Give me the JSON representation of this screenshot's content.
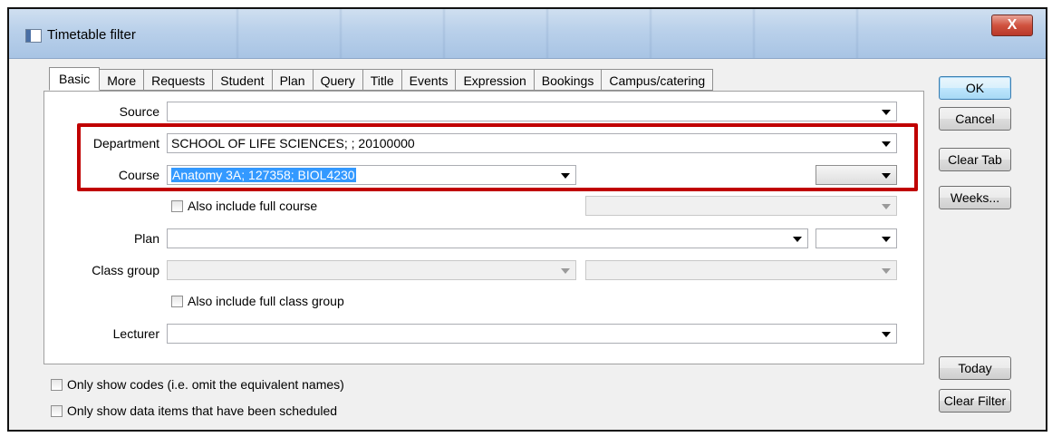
{
  "window": {
    "title": "Timetable filter",
    "close_glyph": "X"
  },
  "tabs": [
    "Basic",
    "More",
    "Requests",
    "Student",
    "Plan",
    "Query",
    "Title",
    "Events",
    "Expression",
    "Bookings",
    "Campus/catering"
  ],
  "form": {
    "source_label": "Source",
    "source_value": "",
    "department_label": "Department",
    "department_value": "SCHOOL OF LIFE SCIENCES; ; 20100000",
    "course_label": "Course",
    "course_value": "Anatomy 3A; 127358; BIOL4230",
    "course_secondary_value": "",
    "include_full_course_label": "Also include full course",
    "include_full_course_checked": false,
    "plan_label": "Plan",
    "plan_value": "",
    "class_group_label": "Class group",
    "class_group_value": "",
    "include_full_class_group_label": "Also include full class group",
    "include_full_class_group_checked": false,
    "lecturer_label": "Lecturer",
    "lecturer_value": ""
  },
  "options": {
    "only_codes_label": "Only show codes (i.e. omit the equivalent names)",
    "only_codes_checked": false,
    "only_scheduled_label": "Only show data items that have been scheduled",
    "only_scheduled_checked": false
  },
  "buttons": {
    "ok": "OK",
    "cancel": "Cancel",
    "clear_tab": "Clear Tab",
    "weeks": "Weeks...",
    "today": "Today",
    "clear_filter": "Clear Filter"
  },
  "colors": {
    "highlight_border": "#c00000",
    "selection": "#3399ff",
    "close_button": "#c8402f"
  }
}
